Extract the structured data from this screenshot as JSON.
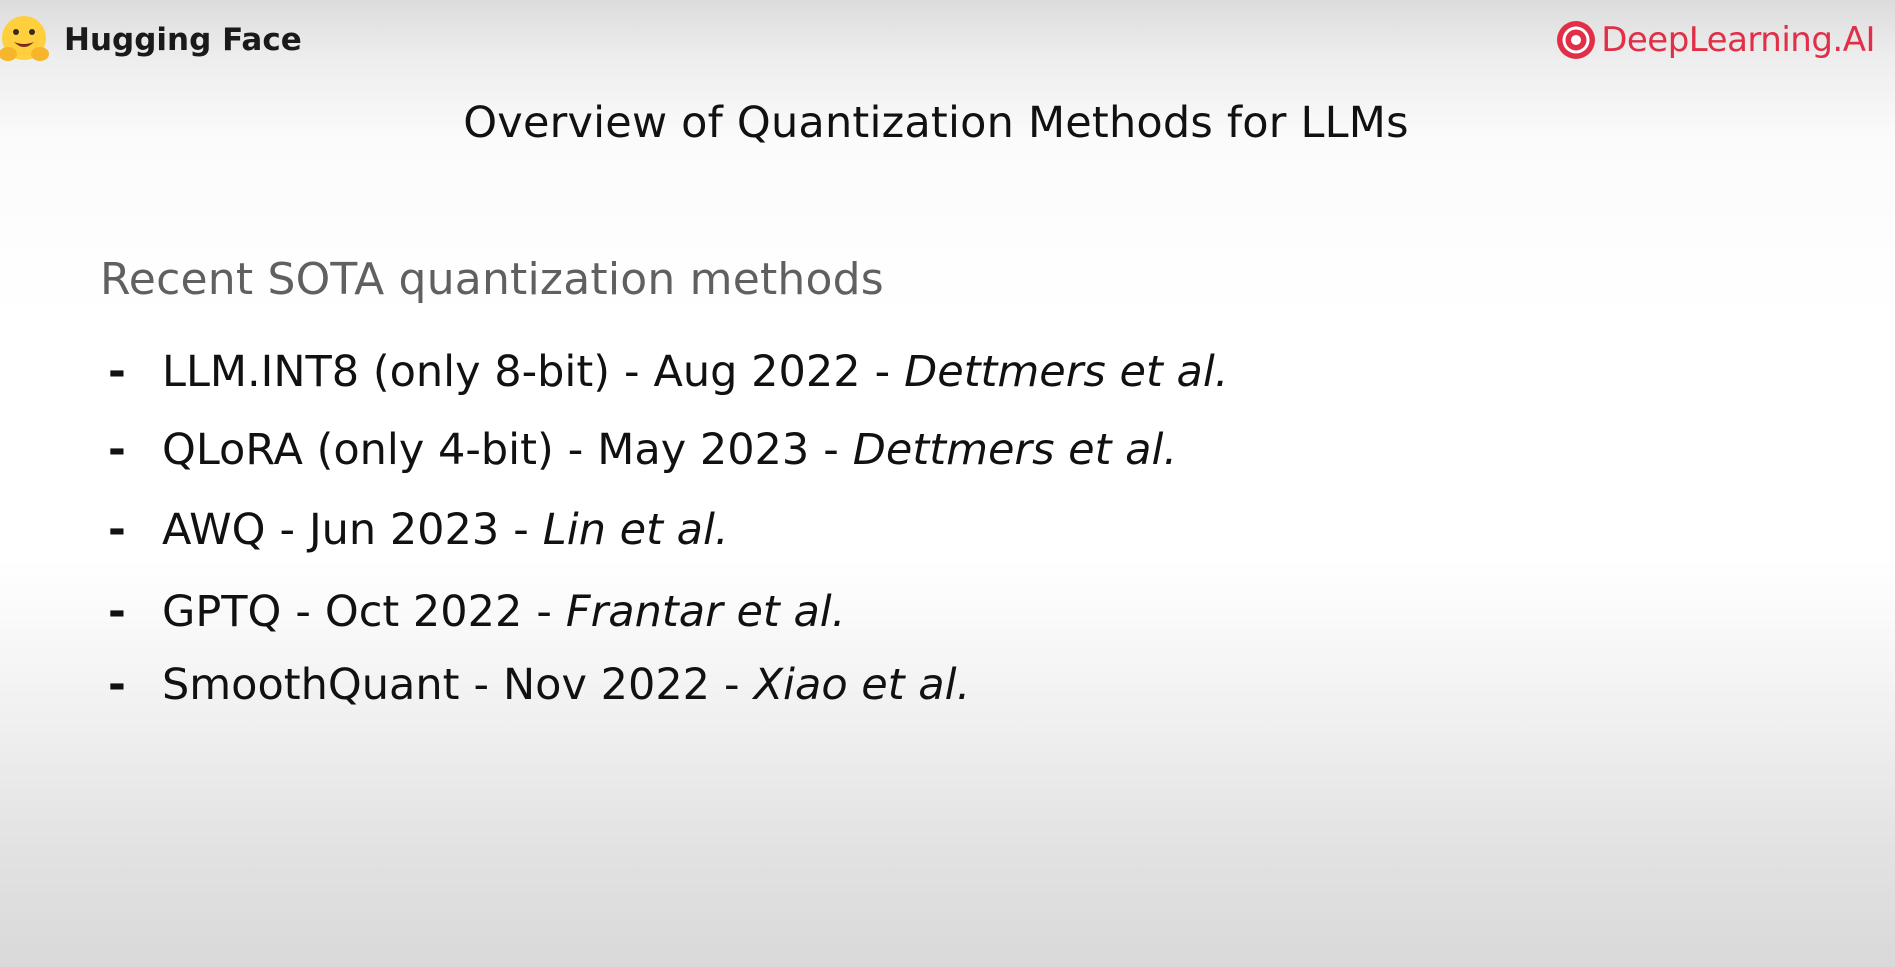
{
  "header": {
    "left_brand": {
      "icon": "hugging-face-emoji-icon",
      "text": "Hugging Face"
    },
    "right_brand": {
      "icon": "deeplearning-ai-logo-icon",
      "text": "DeepLearning.AI",
      "color": "#e02f47"
    }
  },
  "slide": {
    "title": "Overview of Quantization Methods for LLMs",
    "subtitle": "Recent SOTA quantization methods",
    "bullet_glyph": "-",
    "separator": "-",
    "items": [
      {
        "method": "LLM.INT8 (only 8-bit)",
        "date": "Aug 2022",
        "authors": "Dettmers et al."
      },
      {
        "method": "QLoRA (only 4-bit)",
        "date": "May 2023",
        "authors": "Dettmers et al."
      },
      {
        "method": "AWQ",
        "date": "Jun 2023",
        "authors": "Lin et al."
      },
      {
        "method": "GPTQ",
        "date": "Oct 2022",
        "authors": "Frantar et al."
      },
      {
        "method": "SmoothQuant",
        "date": "Nov 2022",
        "authors": "Xiao et al."
      }
    ]
  }
}
